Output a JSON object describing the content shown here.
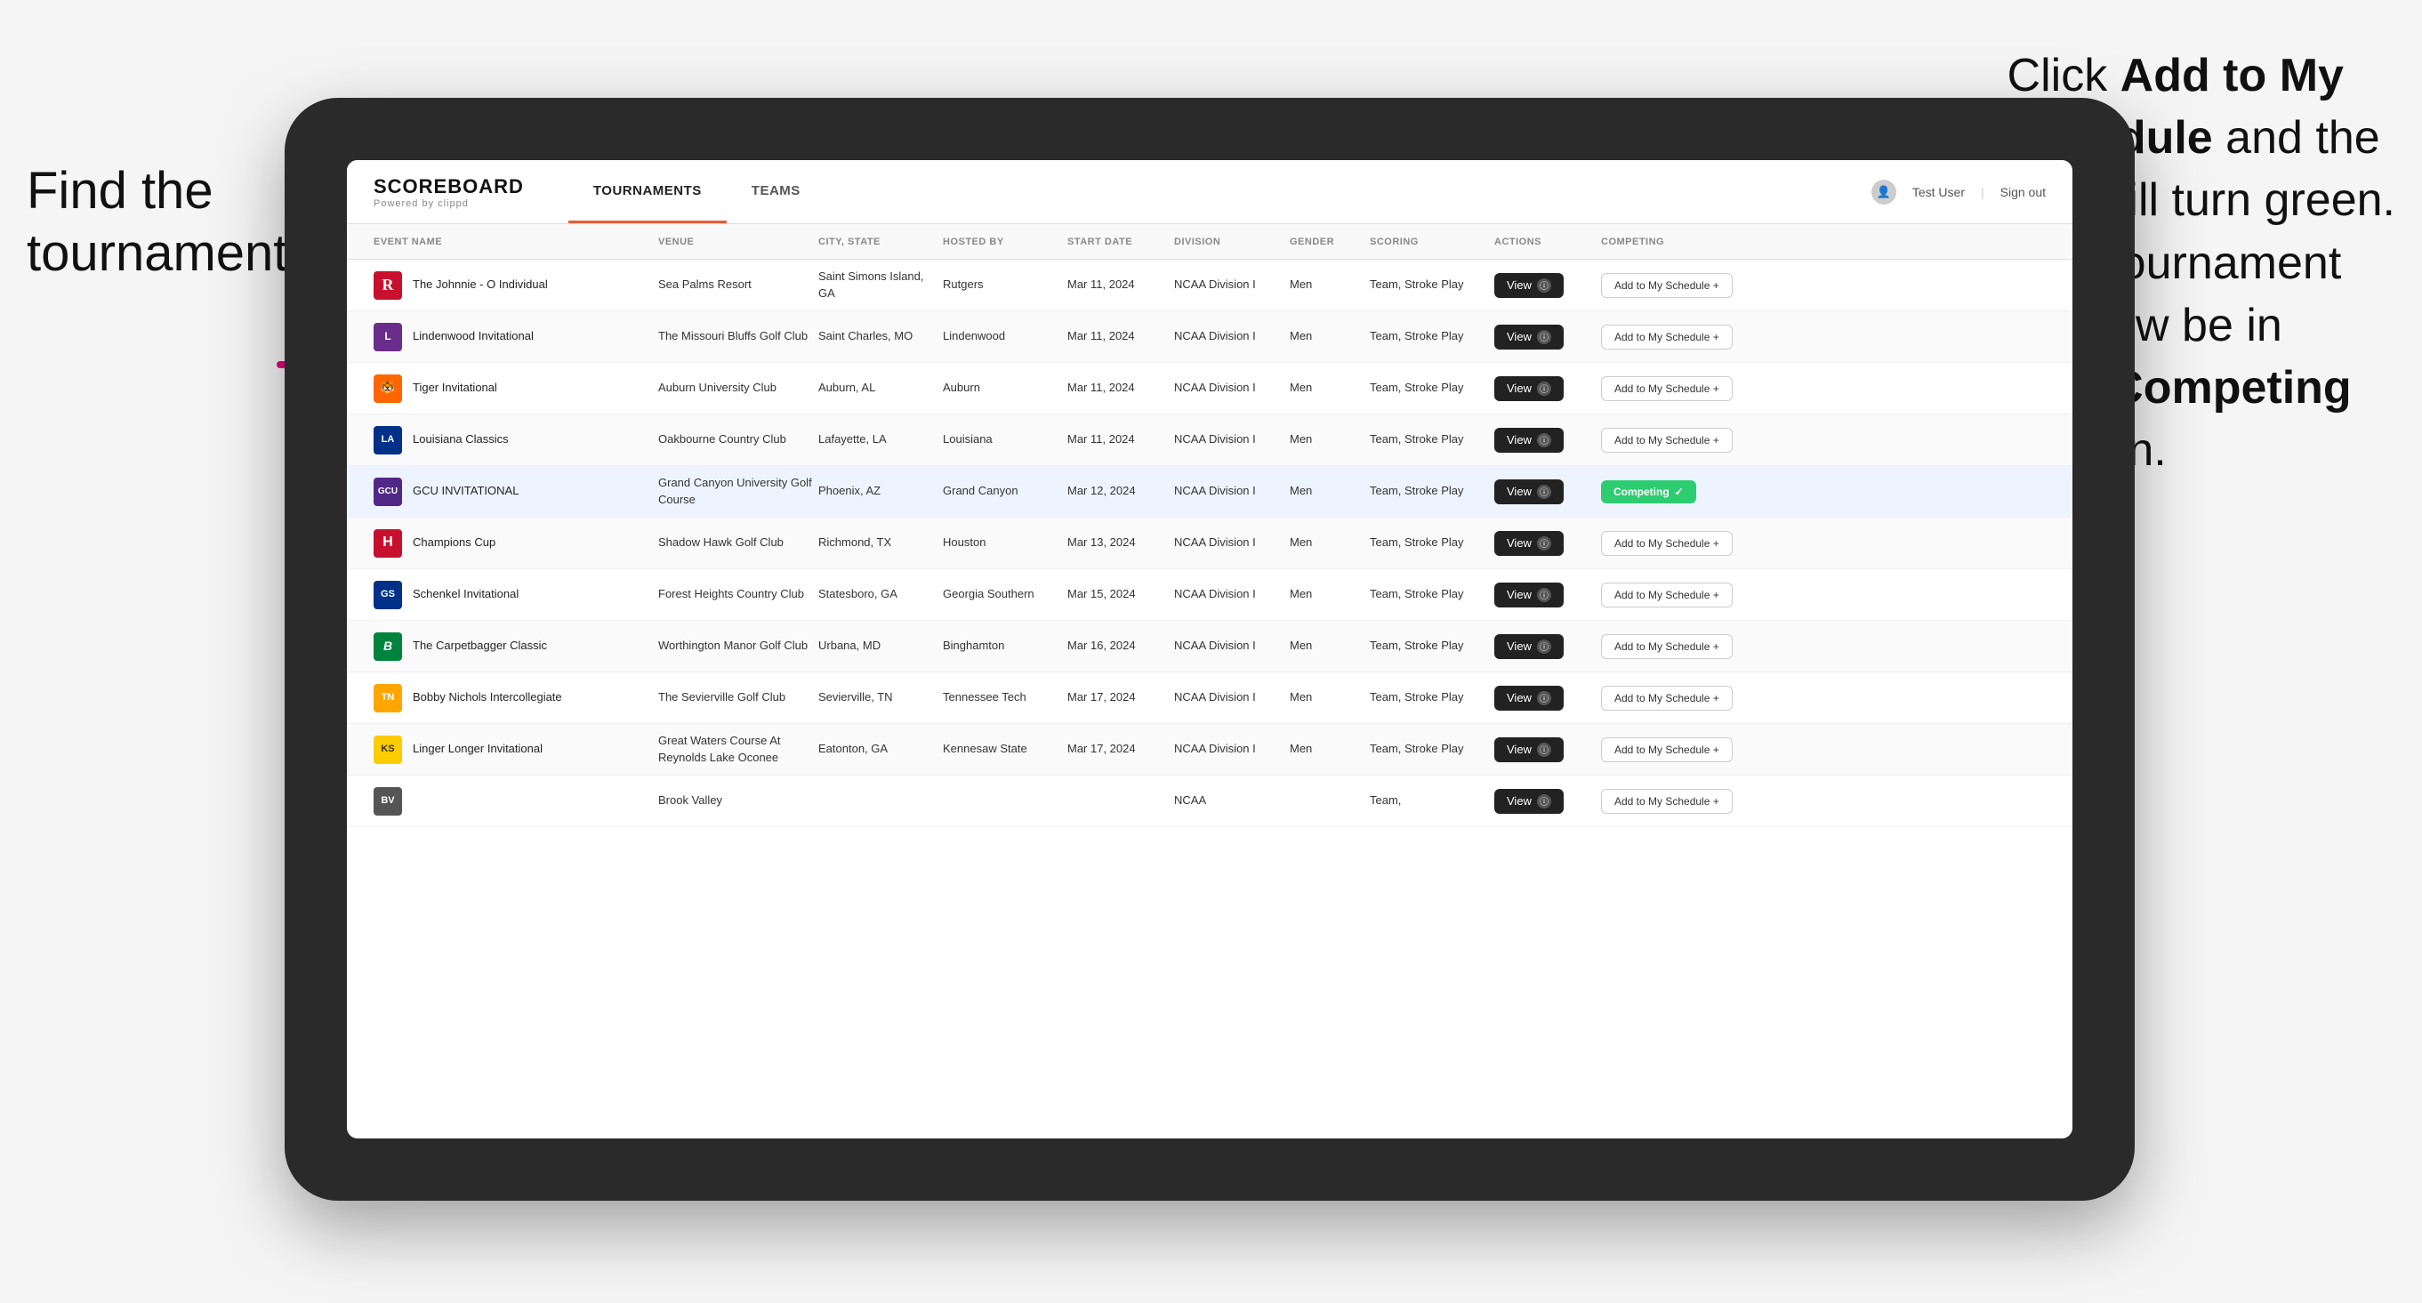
{
  "annotations": {
    "left": "Find the\ntournament.",
    "right_line1": "Click ",
    "right_bold1": "Add to My\nSchedule",
    "right_line2": " and the\nbox will turn green.\nThis tournament\nwill now be in\nyour ",
    "right_bold2": "Competing",
    "right_line3": "\nsection."
  },
  "header": {
    "logo": "SCOREBOARD",
    "logo_sub": "Powered by clippd",
    "nav": [
      "TOURNAMENTS",
      "TEAMS"
    ],
    "active_nav": "TOURNAMENTS",
    "user": "Test User",
    "signout": "Sign out"
  },
  "table": {
    "columns": [
      "EVENT NAME",
      "VENUE",
      "CITY, STATE",
      "HOSTED BY",
      "START DATE",
      "DIVISION",
      "GENDER",
      "SCORING",
      "ACTIONS",
      "COMPETING"
    ],
    "rows": [
      {
        "logo_label": "R",
        "logo_class": "logo-r",
        "event": "The Johnnie - O Individual",
        "venue": "Sea Palms Resort",
        "city_state": "Saint Simons Island, GA",
        "hosted_by": "Rutgers",
        "start_date": "Mar 11, 2024",
        "division": "NCAA Division I",
        "gender": "Men",
        "scoring": "Team, Stroke Play",
        "action": "View",
        "competing_label": "Add to My Schedule +",
        "is_competing": false,
        "highlighted": false
      },
      {
        "logo_label": "L",
        "logo_class": "logo-l",
        "event": "Lindenwood Invitational",
        "venue": "The Missouri Bluffs Golf Club",
        "city_state": "Saint Charles, MO",
        "hosted_by": "Lindenwood",
        "start_date": "Mar 11, 2024",
        "division": "NCAA Division I",
        "gender": "Men",
        "scoring": "Team, Stroke Play",
        "action": "View",
        "competing_label": "Add to My Schedule +",
        "is_competing": false,
        "highlighted": false
      },
      {
        "logo_label": "🐯",
        "logo_class": "logo-t",
        "event": "Tiger Invitational",
        "venue": "Auburn University Club",
        "city_state": "Auburn, AL",
        "hosted_by": "Auburn",
        "start_date": "Mar 11, 2024",
        "division": "NCAA Division I",
        "gender": "Men",
        "scoring": "Team, Stroke Play",
        "action": "View",
        "competing_label": "Add to My Schedule +",
        "is_competing": false,
        "highlighted": false
      },
      {
        "logo_label": "LA",
        "logo_class": "logo-la",
        "event": "Louisiana Classics",
        "venue": "Oakbourne Country Club",
        "city_state": "Lafayette, LA",
        "hosted_by": "Louisiana",
        "start_date": "Mar 11, 2024",
        "division": "NCAA Division I",
        "gender": "Men",
        "scoring": "Team, Stroke Play",
        "action": "View",
        "competing_label": "Add to My Schedule +",
        "is_competing": false,
        "highlighted": false
      },
      {
        "logo_label": "GCU",
        "logo_class": "logo-gcu",
        "event": "GCU INVITATIONAL",
        "venue": "Grand Canyon University Golf Course",
        "city_state": "Phoenix, AZ",
        "hosted_by": "Grand Canyon",
        "start_date": "Mar 12, 2024",
        "division": "NCAA Division I",
        "gender": "Men",
        "scoring": "Team, Stroke Play",
        "action": "View",
        "competing_label": "Competing ✓",
        "is_competing": true,
        "highlighted": true
      },
      {
        "logo_label": "H",
        "logo_class": "logo-h",
        "event": "Champions Cup",
        "venue": "Shadow Hawk Golf Club",
        "city_state": "Richmond, TX",
        "hosted_by": "Houston",
        "start_date": "Mar 13, 2024",
        "division": "NCAA Division I",
        "gender": "Men",
        "scoring": "Team, Stroke Play",
        "action": "View",
        "competing_label": "Add to My Schedule +",
        "is_competing": false,
        "highlighted": false
      },
      {
        "logo_label": "GS",
        "logo_class": "logo-gs",
        "event": "Schenkel Invitational",
        "venue": "Forest Heights Country Club",
        "city_state": "Statesboro, GA",
        "hosted_by": "Georgia Southern",
        "start_date": "Mar 15, 2024",
        "division": "NCAA Division I",
        "gender": "Men",
        "scoring": "Team, Stroke Play",
        "action": "View",
        "competing_label": "Add to My Schedule +",
        "is_competing": false,
        "highlighted": false
      },
      {
        "logo_label": "B",
        "logo_class": "logo-b",
        "event": "The Carpetbagger Classic",
        "venue": "Worthington Manor Golf Club",
        "city_state": "Urbana, MD",
        "hosted_by": "Binghamton",
        "start_date": "Mar 16, 2024",
        "division": "NCAA Division I",
        "gender": "Men",
        "scoring": "Team, Stroke Play",
        "action": "View",
        "competing_label": "Add to My Schedule +",
        "is_competing": false,
        "highlighted": false
      },
      {
        "logo_label": "TN",
        "logo_class": "logo-tn",
        "event": "Bobby Nichols Intercollegiate",
        "venue": "The Sevierville Golf Club",
        "city_state": "Sevierville, TN",
        "hosted_by": "Tennessee Tech",
        "start_date": "Mar 17, 2024",
        "division": "NCAA Division I",
        "gender": "Men",
        "scoring": "Team, Stroke Play",
        "action": "View",
        "competing_label": "Add to My Schedule +",
        "is_competing": false,
        "highlighted": false
      },
      {
        "logo_label": "KS",
        "logo_class": "logo-ks",
        "event": "Linger Longer Invitational",
        "venue": "Great Waters Course At Reynolds Lake Oconee",
        "city_state": "Eatonton, GA",
        "hosted_by": "Kennesaw State",
        "start_date": "Mar 17, 2024",
        "division": "NCAA Division I",
        "gender": "Men",
        "scoring": "Team, Stroke Play",
        "action": "View",
        "competing_label": "Add to My Schedule +",
        "is_competing": false,
        "highlighted": false
      },
      {
        "logo_label": "BV",
        "logo_class": "logo-last",
        "event": "",
        "venue": "Brook Valley",
        "city_state": "",
        "hosted_by": "",
        "start_date": "",
        "division": "NCAA",
        "gender": "",
        "scoring": "Team,",
        "action": "View",
        "competing_label": "Add to My Schedule +",
        "is_competing": false,
        "highlighted": false
      }
    ]
  },
  "colors": {
    "competing_green": "#2ecc71",
    "arrow_pink": "#e5007e",
    "active_tab_accent": "#e85d3a"
  }
}
